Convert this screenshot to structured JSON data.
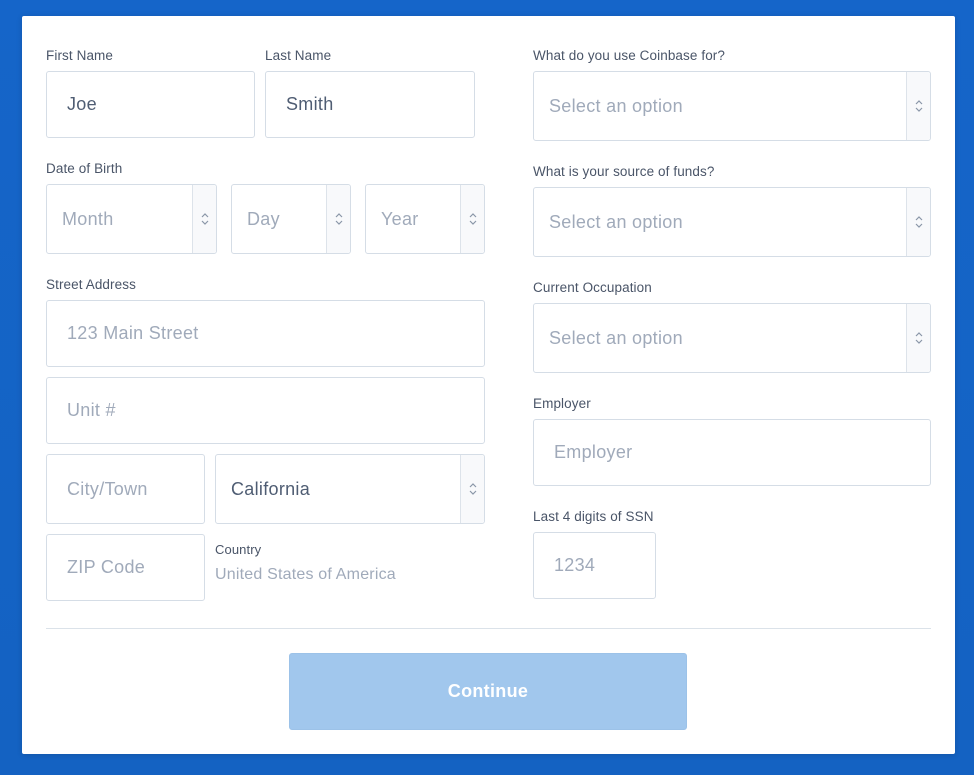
{
  "form": {
    "first_name": {
      "label": "First Name",
      "value": "Joe"
    },
    "last_name": {
      "label": "Last Name",
      "value": "Smith"
    },
    "date_of_birth": {
      "label": "Date of Birth",
      "month_placeholder": "Month",
      "day_placeholder": "Day",
      "year_placeholder": "Year"
    },
    "street_address": {
      "label": "Street Address",
      "street_placeholder": "123 Main Street",
      "unit_placeholder": "Unit #",
      "city_placeholder": "City/Town",
      "state_value": "California",
      "zip_placeholder": "ZIP Code"
    },
    "country": {
      "label": "Country",
      "value": "United States of America"
    },
    "coinbase_use": {
      "label": "What do you use Coinbase for?",
      "placeholder": "Select an option"
    },
    "source_of_funds": {
      "label": "What is your source of funds?",
      "placeholder": "Select an option"
    },
    "occupation": {
      "label": "Current Occupation",
      "placeholder": "Select an option"
    },
    "employer": {
      "label": "Employer",
      "placeholder": "Employer"
    },
    "ssn_last4": {
      "label": "Last 4 digits of SSN",
      "placeholder": "1234"
    },
    "continue_label": "Continue"
  },
  "icons": {
    "stepper": "chevron-up-down-icon"
  },
  "colors": {
    "background": "#1464c4",
    "button_disabled": "#a1c7ed",
    "label_text": "#4a5568",
    "placeholder_text": "#a0aaba",
    "value_text": "#4f5d73",
    "border": "#d5dde6"
  }
}
